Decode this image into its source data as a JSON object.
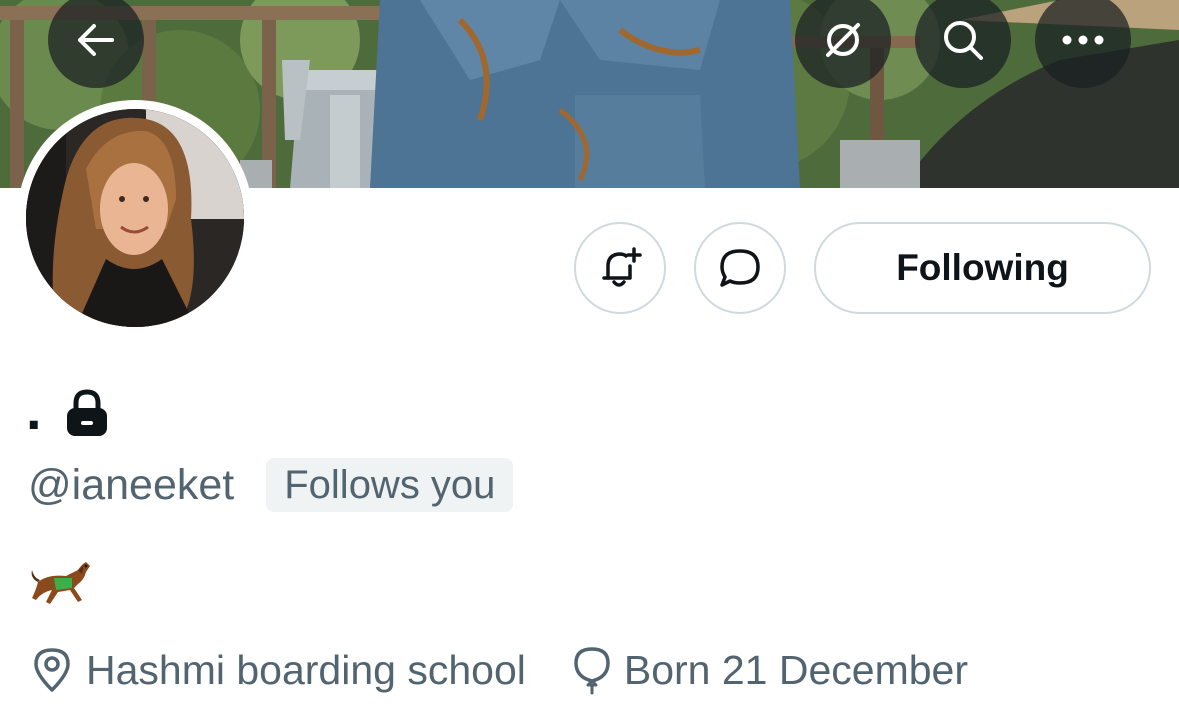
{
  "header": {
    "back_icon": "arrow-left-icon",
    "unfollow_icon": "no-sync-icon",
    "search_icon": "search-icon",
    "more_icon": "more-horizontal-icon"
  },
  "actions": {
    "notify_icon": "bell-plus-icon",
    "message_icon": "chat-bubble-icon",
    "following_label": "Following"
  },
  "profile": {
    "display_name": ".",
    "protected_icon": "lock-icon",
    "handle": "@ianeeket",
    "follows_you_label": "Follows you",
    "bio_emoji_icon": "horse-racing-icon",
    "location": "Hashmi boarding school",
    "location_icon": "location-pin-icon",
    "birthday": "Born 21 December",
    "birthday_icon": "balloon-icon"
  },
  "colors": {
    "text_primary": "#0f1419",
    "text_secondary": "#536471",
    "border": "#cfd9de",
    "badge_bg": "#eff3f4"
  }
}
